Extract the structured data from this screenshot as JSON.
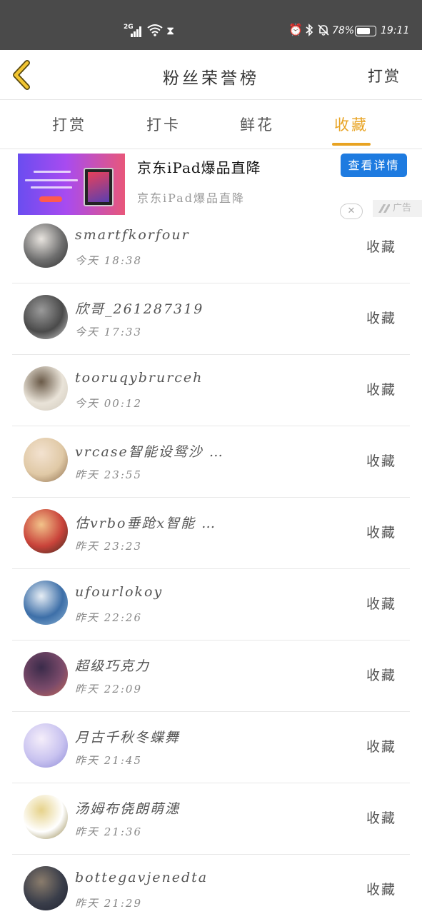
{
  "status_bar": {
    "network": "2G",
    "battery_percent": "78%",
    "battery_level": 0.78,
    "time": "19:11",
    "icons": [
      "signal-icon",
      "wifi-icon",
      "hourglass-icon",
      "alarm-icon",
      "bluetooth-icon",
      "mute-icon",
      "battery-icon"
    ]
  },
  "header": {
    "title": "粉丝荣誉榜",
    "action": "打赏",
    "back_icon": "chevron-left-icon",
    "accent_color": "#e8a322"
  },
  "tabs": [
    {
      "label": "打赏",
      "active": false
    },
    {
      "label": "打卡",
      "active": false
    },
    {
      "label": "鲜花",
      "active": false
    },
    {
      "label": "收藏",
      "active": true
    }
  ],
  "ad": {
    "title": "京东iPad爆品直降",
    "subtitle": "京东iPad爆品直降",
    "button": "查看详情",
    "close_icon": "close-icon",
    "badge": "广告"
  },
  "list": [
    {
      "name": "smartfkorfour",
      "time": "今天 18:38",
      "action": "收藏",
      "avatar_colors": [
        "#6e6e6e",
        "#e8e4df",
        "#2f2f2f"
      ]
    },
    {
      "name": "欣哥_261287319",
      "time": "今天 17:33",
      "action": "收藏",
      "avatar_colors": [
        "#4a4a4a",
        "#9a9a9a",
        "#d5d5d5"
      ]
    },
    {
      "name": "tooruqybrurceh",
      "time": "今天 00:12",
      "action": "收藏",
      "avatar_colors": [
        "#e9e3d8",
        "#6a5a48",
        "#cfc8bb"
      ]
    },
    {
      "name": "vrcase智能设鸳沙 …",
      "time": "昨天 23:55",
      "action": "收藏",
      "avatar_colors": [
        "#e0c9a6",
        "#f3e2d0",
        "#8b6b4a"
      ]
    },
    {
      "name": "估vrbo垂跄x智能 …",
      "time": "昨天 23:23",
      "action": "收藏",
      "avatar_colors": [
        "#c9433a",
        "#f2c38a",
        "#3a2a20"
      ]
    },
    {
      "name": "ufourlokoy",
      "time": "昨天 22:26",
      "action": "收藏",
      "avatar_colors": [
        "#3d6fa8",
        "#e7eef5",
        "#8db4d6"
      ]
    },
    {
      "name": "超级巧克力",
      "time": "昨天 22:09",
      "action": "收藏",
      "avatar_colors": [
        "#7a4a6a",
        "#3a2b4a",
        "#c46a5a"
      ]
    },
    {
      "name": "月古千秋冬蝶舞",
      "time": "昨天 21:45",
      "action": "收藏",
      "avatar_colors": [
        "#c9c3f0",
        "#f5eefa",
        "#8d8ad6"
      ]
    },
    {
      "name": "汤姆布侥朗萌漶",
      "time": "昨天 21:36",
      "action": "收藏",
      "avatar_colors": [
        "#ffffff",
        "#e6d28a",
        "#8a7a3a"
      ]
    },
    {
      "name": "bottegavjenedta",
      "time": "昨天 21:29",
      "action": "收藏",
      "avatar_colors": [
        "#3a3e4a",
        "#8a7c6c",
        "#1f2230"
      ]
    }
  ]
}
